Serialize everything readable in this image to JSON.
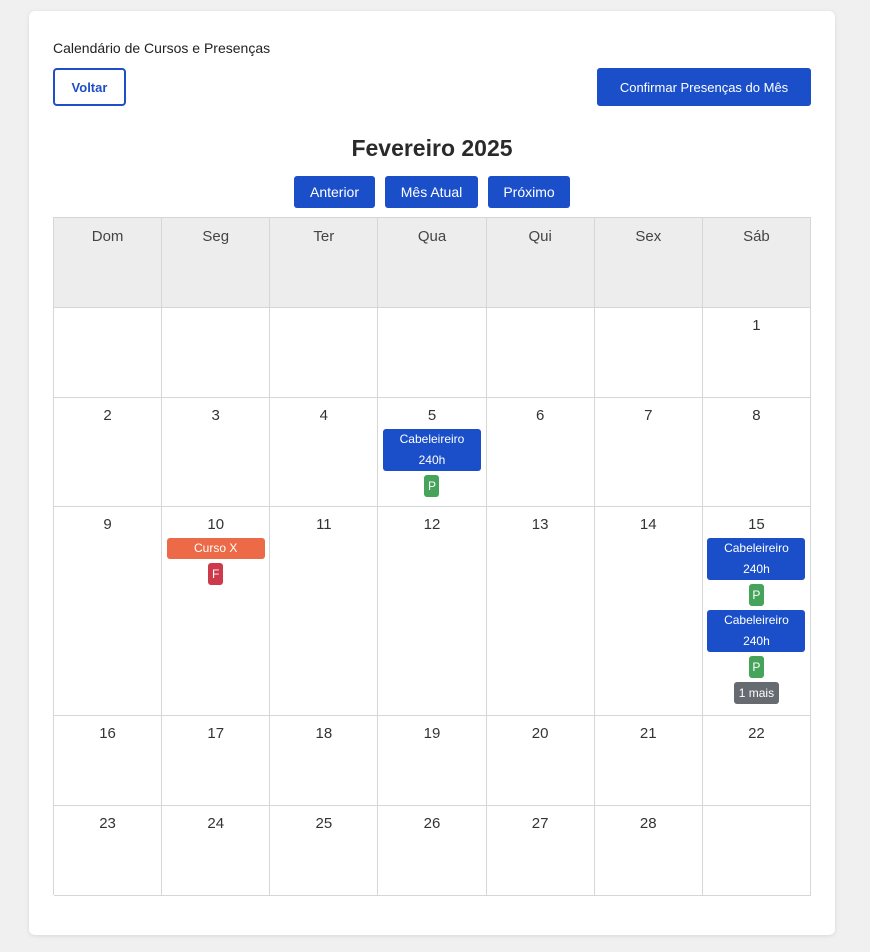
{
  "page": {
    "title": "Calendário de Cursos e Presenças",
    "back_label": "Voltar",
    "confirm_label": "Confirmar Presenças do Mês"
  },
  "calendar": {
    "month_title": "Fevereiro 2025",
    "nav": {
      "prev": "Anterior",
      "current": "Mês Atual",
      "next": "Próximo"
    },
    "weekdays": [
      "Dom",
      "Seg",
      "Ter",
      "Qua",
      "Qui",
      "Sex",
      "Sáb"
    ],
    "weeks": [
      [
        {
          "day": ""
        },
        {
          "day": ""
        },
        {
          "day": ""
        },
        {
          "day": ""
        },
        {
          "day": ""
        },
        {
          "day": ""
        },
        {
          "day": "1"
        }
      ],
      [
        {
          "day": "2"
        },
        {
          "day": "3"
        },
        {
          "day": "4"
        },
        {
          "day": "5",
          "events": [
            {
              "label": "Cabeleireiro 240h",
              "color": "blue",
              "status": "P"
            }
          ]
        },
        {
          "day": "6"
        },
        {
          "day": "7"
        },
        {
          "day": "8"
        }
      ],
      [
        {
          "day": "9"
        },
        {
          "day": "10",
          "events": [
            {
              "label": "Curso X",
              "color": "orange",
              "status": "F"
            }
          ]
        },
        {
          "day": "11"
        },
        {
          "day": "12"
        },
        {
          "day": "13"
        },
        {
          "day": "14"
        },
        {
          "day": "15",
          "events": [
            {
              "label": "Cabeleireiro 240h",
              "color": "blue",
              "status": "P"
            },
            {
              "label": "Cabeleireiro 240h",
              "color": "blue",
              "status": "P"
            }
          ],
          "more": "1 mais"
        }
      ],
      [
        {
          "day": "16"
        },
        {
          "day": "17"
        },
        {
          "day": "18"
        },
        {
          "day": "19"
        },
        {
          "day": "20"
        },
        {
          "day": "21"
        },
        {
          "day": "22"
        }
      ],
      [
        {
          "day": "23"
        },
        {
          "day": "24"
        },
        {
          "day": "25"
        },
        {
          "day": "26"
        },
        {
          "day": "27"
        },
        {
          "day": "28"
        },
        {
          "day": ""
        }
      ]
    ]
  },
  "colors": {
    "primary": "#1a4fc9",
    "event_orange": "#ec6a47",
    "present_green": "#46a35a",
    "absent_red": "#cc3a4b",
    "more_gray": "#666b72"
  }
}
